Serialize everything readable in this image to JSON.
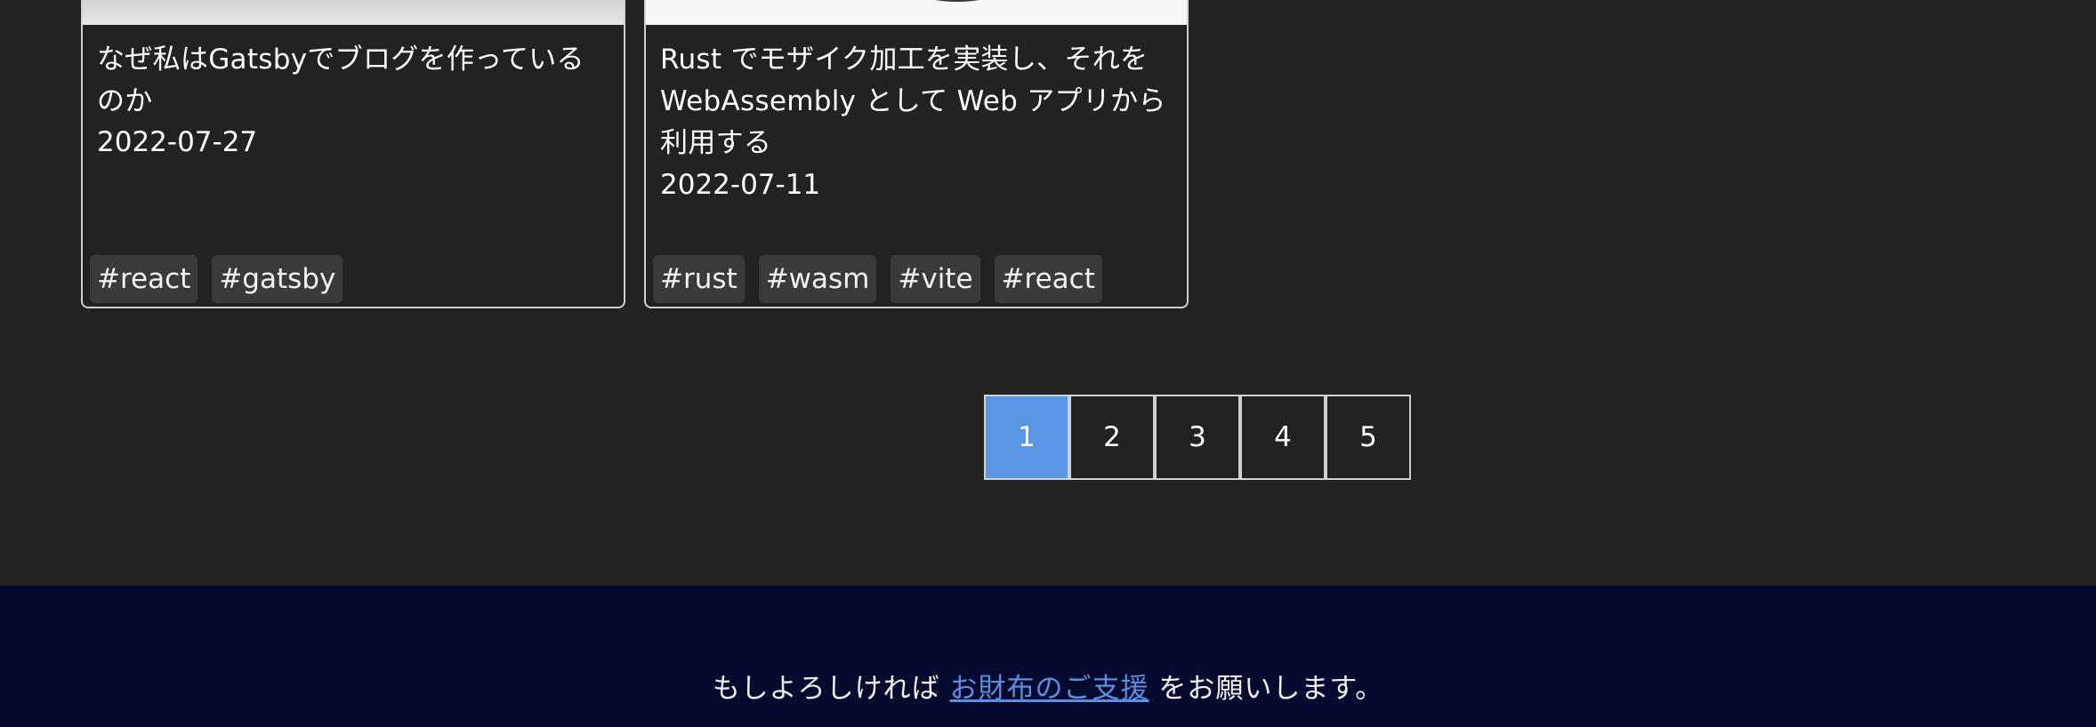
{
  "posts": [
    {
      "title": "なぜ私はGatsbyでブログを作っているのか",
      "date": "2022-07-27",
      "tags": [
        "#react",
        "#gatsby"
      ]
    },
    {
      "title": "Rust でモザイク加工を実装し、それを WebAssembly として Web アプリから利用する",
      "date": "2022-07-11",
      "tags": [
        "#rust",
        "#wasm",
        "#vite",
        "#react"
      ]
    }
  ],
  "pagination": {
    "pages": [
      "1",
      "2",
      "3",
      "4",
      "5"
    ],
    "current": "1"
  },
  "footer": {
    "prefix": "もしよろしければ ",
    "link": "お財布のご支援",
    "suffix": " をお願いします。"
  },
  "colors": {
    "background": "#222222",
    "active_page": "#5a96e3",
    "footer_bg": "#060a2e",
    "link": "#5b8fe0"
  }
}
